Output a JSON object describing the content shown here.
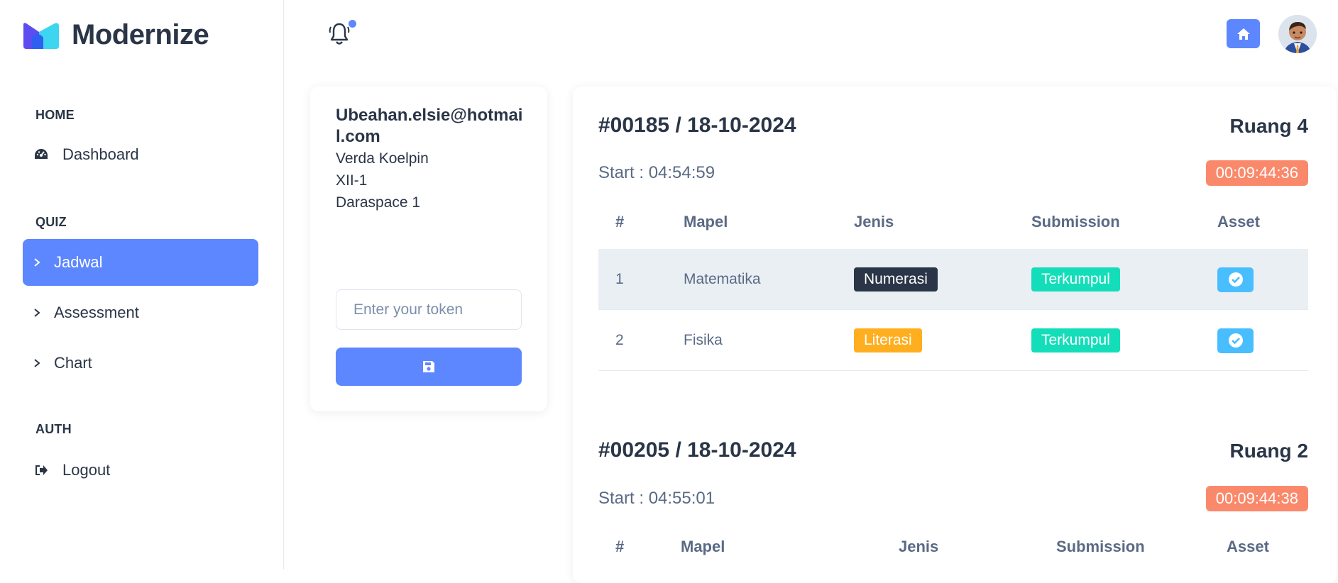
{
  "brand": {
    "name": "Modernize",
    "colors": {
      "primary": "#5d87ff",
      "cyan": "#49beff",
      "dark": "#2a3547"
    }
  },
  "sidebar": {
    "sections": [
      {
        "title": "HOME"
      },
      {
        "title": "QUIZ"
      },
      {
        "title": "AUTH"
      }
    ],
    "items": [
      {
        "label": "Dashboard",
        "icon": "dashboard-icon"
      },
      {
        "label": "Jadwal",
        "icon": "chevron-right-icon",
        "active": true
      },
      {
        "label": "Assessment",
        "icon": "chevron-right-icon"
      },
      {
        "label": "Chart",
        "icon": "chevron-right-icon"
      },
      {
        "label": "Logout",
        "icon": "logout-icon"
      }
    ]
  },
  "header": {
    "bell_icon": "bell-icon",
    "home_icon": "home-icon"
  },
  "profile": {
    "email": "Ubeahan.elsie@hotmail.com",
    "name": "Verda Koelpin",
    "class": "XII-1",
    "school": "Daraspace 1",
    "token_placeholder": "Enter your token",
    "save_icon": "save-icon"
  },
  "exams": [
    {
      "title": "#00185 / 18-10-2024",
      "room": "Ruang 4",
      "start": "Start : 04:54:59",
      "timer": "00:09:44:36",
      "columns": [
        "#",
        "Mapel",
        "Jenis",
        "Submission",
        "Asset"
      ],
      "rows": [
        {
          "no": "1",
          "mapel": "Matematika",
          "jenis": "Numerasi",
          "jenis_color": "dark",
          "submission": "Terkumpul"
        },
        {
          "no": "2",
          "mapel": "Fisika",
          "jenis": "Literasi",
          "jenis_color": "orange",
          "submission": "Terkumpul"
        }
      ]
    },
    {
      "title": "#00205 / 18-10-2024",
      "room": "Ruang 2",
      "start": "Start : 04:55:01",
      "timer": "00:09:44:38",
      "columns": [
        "#",
        "Mapel",
        "Jenis",
        "Submission",
        "Asset"
      ]
    }
  ]
}
